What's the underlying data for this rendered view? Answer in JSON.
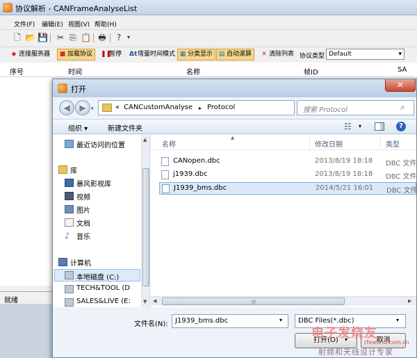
{
  "app": {
    "title": "协议解析 - CANFrameAnalyseList",
    "menu": [
      "文件(F)",
      "编辑(E)",
      "视图(V)",
      "帮助(H)"
    ],
    "toolbar2": {
      "connect": "连接服务器",
      "load_protocol": "加载协议",
      "pause": "暂停",
      "increment_time": "增量时间模式",
      "category_display": "分类显示",
      "auto_scroll": "自动滚屏",
      "clear_list": "清除列表",
      "protocol_type_label": "协议类型",
      "protocol_type_value": "Default"
    },
    "columns": [
      "序号",
      "时间",
      "名称",
      "帧ID",
      "SA"
    ],
    "status": "就绪"
  },
  "dialog": {
    "title": "打开",
    "address": {
      "prefix": "«",
      "part1": "CANCustomAnalyse",
      "sep": "▸",
      "part2": "Protocol"
    },
    "search_placeholder": "搜索 Protocol",
    "organize": "组织 ▾",
    "new_folder": "新建文件夹",
    "nav_items": {
      "recent": "最近访问的位置",
      "library": "库",
      "storm": "暴风影视库",
      "videos": "视频",
      "pictures": "图片",
      "documents": "文档",
      "music": "音乐",
      "computer": "计算机",
      "local_disk": "本地磁盘 (C:)",
      "tech": "TECH&TOOL (D",
      "sales": "SALES&LIVE (E:"
    },
    "file_columns": {
      "name": "名称",
      "modified": "修改日期",
      "type": "类型"
    },
    "files": [
      {
        "name": "CANopen.dbc",
        "date": "2013/8/19 18:18",
        "type": "DBC 文件"
      },
      {
        "name": "j1939.dbc",
        "date": "2013/8/19 18:18",
        "type": "DBC 文件"
      },
      {
        "name": "J1939_bms.dbc",
        "date": "2014/5/21 16:01",
        "type": "DBC 文件"
      }
    ],
    "filename_label": "文件名(N):",
    "filename_value": "J1939_bms.dbc",
    "filetype_value": "DBC Files(*.dbc)",
    "open_button": "打开(O)",
    "cancel_button": "取消"
  },
  "watermark": {
    "big": "电子发烧友",
    "url": "rfeworld.com.cn",
    "small": "射频和天线设计专家"
  }
}
